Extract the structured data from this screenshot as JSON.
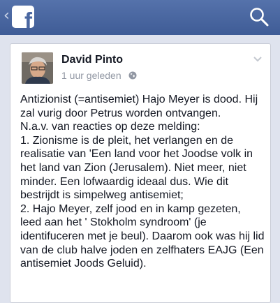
{
  "header": {
    "back_glyph": "‹",
    "logo_letter": "f"
  },
  "post": {
    "author": "David Pinto",
    "timestamp": "1 uur geleden",
    "text": "Antizionist (=antisemiet) Hajo Meyer is dood. Hij zal vurig door Petrus worden ontvangen.\nN.a.v. van reacties op deze melding:\n1. Zionisme is de pleit, het verlangen en de realisatie van 'Een land voor het Joodse volk in het land van Zion (Jerusalem). Niet meer, niet minder. Een lofwaardig ideaal dus. Wie dit bestrijdt is simpelweg antisemiet;\n2. Hajo Meyer, zelf jood en in kamp gezeten, leed aan het ' Stokholm syndroom' (je identifuceren met je beul). Daarom ook was hij lid van de club halve joden en zelfhaters EAJG (Een antisemiet Joods Geluid)."
  },
  "icons": {
    "back": "back-chevron-icon",
    "logo": "facebook-logo-icon",
    "search": "search-icon",
    "privacy": "globe-icon",
    "menu": "chevron-down-icon"
  },
  "colors": {
    "header_blue": "#4a67a1",
    "background": "#dfe3ee",
    "text": "#141823",
    "meta": "#9197a3"
  }
}
